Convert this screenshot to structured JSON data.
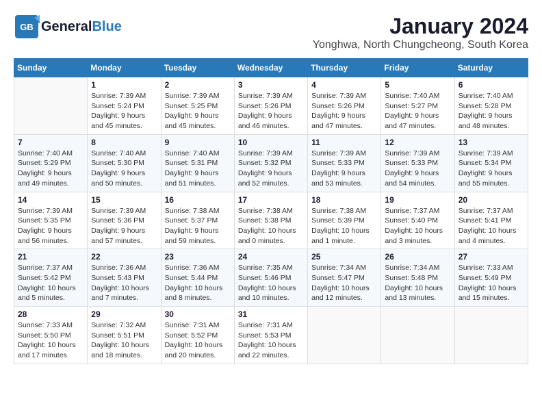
{
  "header": {
    "logo_line1": "General",
    "logo_line2": "Blue",
    "month_title": "January 2024",
    "location": "Yonghwa, North Chungcheong, South Korea"
  },
  "days_of_week": [
    "Sunday",
    "Monday",
    "Tuesday",
    "Wednesday",
    "Thursday",
    "Friday",
    "Saturday"
  ],
  "weeks": [
    [
      {
        "day": "",
        "info": ""
      },
      {
        "day": "1",
        "info": "Sunrise: 7:39 AM\nSunset: 5:24 PM\nDaylight: 9 hours\nand 45 minutes."
      },
      {
        "day": "2",
        "info": "Sunrise: 7:39 AM\nSunset: 5:25 PM\nDaylight: 9 hours\nand 45 minutes."
      },
      {
        "day": "3",
        "info": "Sunrise: 7:39 AM\nSunset: 5:26 PM\nDaylight: 9 hours\nand 46 minutes."
      },
      {
        "day": "4",
        "info": "Sunrise: 7:39 AM\nSunset: 5:26 PM\nDaylight: 9 hours\nand 47 minutes."
      },
      {
        "day": "5",
        "info": "Sunrise: 7:40 AM\nSunset: 5:27 PM\nDaylight: 9 hours\nand 47 minutes."
      },
      {
        "day": "6",
        "info": "Sunrise: 7:40 AM\nSunset: 5:28 PM\nDaylight: 9 hours\nand 48 minutes."
      }
    ],
    [
      {
        "day": "7",
        "info": "Sunrise: 7:40 AM\nSunset: 5:29 PM\nDaylight: 9 hours\nand 49 minutes."
      },
      {
        "day": "8",
        "info": "Sunrise: 7:40 AM\nSunset: 5:30 PM\nDaylight: 9 hours\nand 50 minutes."
      },
      {
        "day": "9",
        "info": "Sunrise: 7:40 AM\nSunset: 5:31 PM\nDaylight: 9 hours\nand 51 minutes."
      },
      {
        "day": "10",
        "info": "Sunrise: 7:39 AM\nSunset: 5:32 PM\nDaylight: 9 hours\nand 52 minutes."
      },
      {
        "day": "11",
        "info": "Sunrise: 7:39 AM\nSunset: 5:33 PM\nDaylight: 9 hours\nand 53 minutes."
      },
      {
        "day": "12",
        "info": "Sunrise: 7:39 AM\nSunset: 5:33 PM\nDaylight: 9 hours\nand 54 minutes."
      },
      {
        "day": "13",
        "info": "Sunrise: 7:39 AM\nSunset: 5:34 PM\nDaylight: 9 hours\nand 55 minutes."
      }
    ],
    [
      {
        "day": "14",
        "info": "Sunrise: 7:39 AM\nSunset: 5:35 PM\nDaylight: 9 hours\nand 56 minutes."
      },
      {
        "day": "15",
        "info": "Sunrise: 7:39 AM\nSunset: 5:36 PM\nDaylight: 9 hours\nand 57 minutes."
      },
      {
        "day": "16",
        "info": "Sunrise: 7:38 AM\nSunset: 5:37 PM\nDaylight: 9 hours\nand 59 minutes."
      },
      {
        "day": "17",
        "info": "Sunrise: 7:38 AM\nSunset: 5:38 PM\nDaylight: 10 hours\nand 0 minutes."
      },
      {
        "day": "18",
        "info": "Sunrise: 7:38 AM\nSunset: 5:39 PM\nDaylight: 10 hours\nand 1 minute."
      },
      {
        "day": "19",
        "info": "Sunrise: 7:37 AM\nSunset: 5:40 PM\nDaylight: 10 hours\nand 3 minutes."
      },
      {
        "day": "20",
        "info": "Sunrise: 7:37 AM\nSunset: 5:41 PM\nDaylight: 10 hours\nand 4 minutes."
      }
    ],
    [
      {
        "day": "21",
        "info": "Sunrise: 7:37 AM\nSunset: 5:42 PM\nDaylight: 10 hours\nand 5 minutes."
      },
      {
        "day": "22",
        "info": "Sunrise: 7:36 AM\nSunset: 5:43 PM\nDaylight: 10 hours\nand 7 minutes."
      },
      {
        "day": "23",
        "info": "Sunrise: 7:36 AM\nSunset: 5:44 PM\nDaylight: 10 hours\nand 8 minutes."
      },
      {
        "day": "24",
        "info": "Sunrise: 7:35 AM\nSunset: 5:46 PM\nDaylight: 10 hours\nand 10 minutes."
      },
      {
        "day": "25",
        "info": "Sunrise: 7:34 AM\nSunset: 5:47 PM\nDaylight: 10 hours\nand 12 minutes."
      },
      {
        "day": "26",
        "info": "Sunrise: 7:34 AM\nSunset: 5:48 PM\nDaylight: 10 hours\nand 13 minutes."
      },
      {
        "day": "27",
        "info": "Sunrise: 7:33 AM\nSunset: 5:49 PM\nDaylight: 10 hours\nand 15 minutes."
      }
    ],
    [
      {
        "day": "28",
        "info": "Sunrise: 7:33 AM\nSunset: 5:50 PM\nDaylight: 10 hours\nand 17 minutes."
      },
      {
        "day": "29",
        "info": "Sunrise: 7:32 AM\nSunset: 5:51 PM\nDaylight: 10 hours\nand 18 minutes."
      },
      {
        "day": "30",
        "info": "Sunrise: 7:31 AM\nSunset: 5:52 PM\nDaylight: 10 hours\nand 20 minutes."
      },
      {
        "day": "31",
        "info": "Sunrise: 7:31 AM\nSunset: 5:53 PM\nDaylight: 10 hours\nand 22 minutes."
      },
      {
        "day": "",
        "info": ""
      },
      {
        "day": "",
        "info": ""
      },
      {
        "day": "",
        "info": ""
      }
    ]
  ]
}
